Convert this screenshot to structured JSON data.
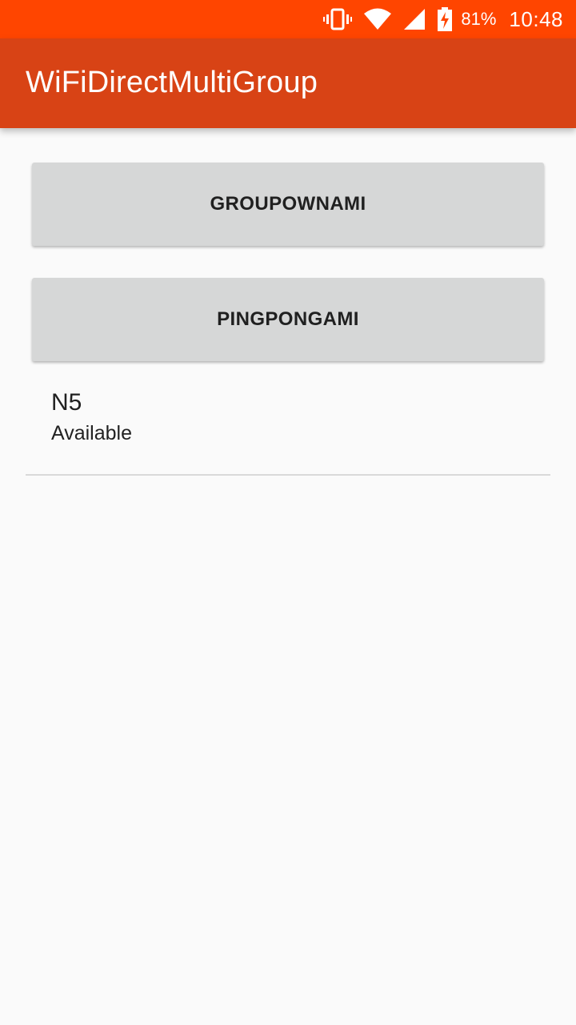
{
  "status_bar": {
    "background": "#ff4500",
    "icons": [
      "vibrate-icon",
      "wifi-icon",
      "cell-signal-icon",
      "battery-charging-icon"
    ],
    "battery_percent": "81%",
    "time": "10:48"
  },
  "app_bar": {
    "background": "#d84315",
    "title": "WiFiDirectMultiGroup"
  },
  "buttons": {
    "group_own": "GROUPOWNAMI",
    "ping_pong": "PINGPONGAMI"
  },
  "devices": [
    {
      "name": "N5",
      "status": "Available"
    }
  ]
}
